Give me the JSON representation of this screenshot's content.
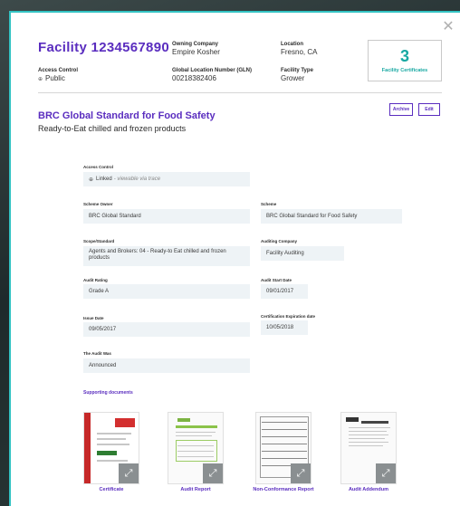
{
  "header": {
    "facility_title": "Facility 1234567890",
    "owning_company": {
      "label": "Owning Company",
      "value": "Empire Kosher"
    },
    "location": {
      "label": "Location",
      "value": "Fresno, CA"
    },
    "access_control": {
      "label": "Access Control",
      "value": "Public"
    },
    "gln": {
      "label": "Global Location Number (GLN)",
      "value": "00218382406"
    },
    "facility_type": {
      "label": "Facility Type",
      "value": "Grower"
    },
    "certificates": {
      "count": "3",
      "label": "Facility Certificates"
    }
  },
  "actions": {
    "archive": "Archive",
    "edit": "Edit"
  },
  "standard": {
    "title": "BRC Global Standard for Food Safety",
    "subtitle": "Ready-to-Eat chilled and frozen products"
  },
  "fields": {
    "access_control": {
      "label": "Access Control",
      "value": "Linked",
      "note": "- viewable via trace"
    },
    "scheme_owner": {
      "label": "Scheme Owner",
      "value": "BRC Global Standard"
    },
    "scheme": {
      "label": "Scheme",
      "value": "BRC Global Standard for Food Safety"
    },
    "scope": {
      "label": "Scope/Standard",
      "value": "Agents and Brokers: 04 - Ready-to Eat chilled and frozen products"
    },
    "auditing_company": {
      "label": "Auditing Company",
      "value": "Facility Auditing"
    },
    "audit_rating": {
      "label": "Audit Rating",
      "value": "Grade A"
    },
    "audit_start": {
      "label": "Audit Start Date",
      "value": "09/01/2017"
    },
    "issue_date": {
      "label": "Issue Date",
      "value": "09/05/2017"
    },
    "expiration": {
      "label": "Certification Expiration date",
      "value": "10/05/2018"
    },
    "audit_was": {
      "label": "The Audit Was",
      "value": "Announced"
    }
  },
  "documents": {
    "heading": "Supporting documents",
    "items": [
      {
        "label": "Certificate",
        "icon": "expand-icon"
      },
      {
        "label": "Audit Report",
        "icon": "expand-icon"
      },
      {
        "label": "Non-Conformance Report",
        "icon": "expand-icon"
      },
      {
        "label": "Audit Addendum",
        "icon": "expand-icon"
      }
    ]
  },
  "colors": {
    "accent": "#5a2dbf",
    "teal": "#17a8a2",
    "border": "#33c3c3"
  }
}
